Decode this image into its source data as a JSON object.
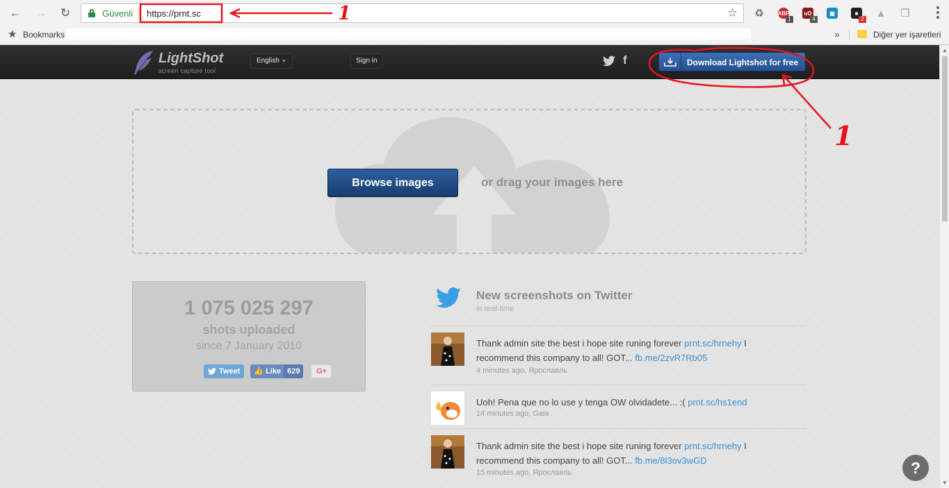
{
  "browser": {
    "secure_label": "Güvenli",
    "url": "https://prnt.sc",
    "bookmarks_label": "Bookmarks",
    "other_bookmarks": "Diğer yer işaretleri",
    "extensions": [
      {
        "name": "recycle",
        "badge": ""
      },
      {
        "name": "abp",
        "badge": "1"
      },
      {
        "name": "ublock",
        "badge": "4"
      },
      {
        "name": "reader",
        "badge": ""
      },
      {
        "name": "ext-dark",
        "badge": "2"
      },
      {
        "name": "drive",
        "badge": ""
      },
      {
        "name": "copy",
        "badge": ""
      }
    ]
  },
  "site": {
    "logo_name": "LightShot",
    "logo_tagline": "screen capture tool",
    "language": "English",
    "signin": "Sign in",
    "download": "Download Lightshot for free",
    "browse": "Browse images",
    "drag": "or drag your images here",
    "counter": {
      "number": "1 075 025 297",
      "label": "shots uploaded",
      "since": "since 7 January 2010"
    },
    "social": {
      "tweet": "Tweet",
      "like": "Like",
      "like_count": "629",
      "gplus": "G+"
    },
    "feed": {
      "title": "New screenshots on Twitter",
      "subtitle": "in real-time",
      "items": [
        {
          "text": "Thank admin site the best i hope site runing forever ",
          "link1": "prnt.sc/hrnehy",
          "text2": " I recommend this company to all! GOT... ",
          "link2": "fb.me/2zvR7Rb05",
          "meta": "4 minutes ago, Ярославль"
        },
        {
          "text": "Uoh! Pena que no lo use y tenga OW olvidadete... :( ",
          "link1": "prnt.sc/hs1end",
          "text2": "",
          "link2": "",
          "meta": "14 minutes ago, Gaia"
        },
        {
          "text": "Thank admin site the best i hope site runing forever ",
          "link1": "prnt.sc/hrnehy",
          "text2": " I recommend this company to all! GOT... ",
          "link2": "fb.me/8l3ov3wGD",
          "meta": "15 minutes ago, Ярославль"
        }
      ]
    },
    "help": "?"
  },
  "annotations": {
    "label1": "1",
    "label2": "1",
    "color": "#e8141c"
  },
  "colors": {
    "accent_blue": "#24508f",
    "link_blue": "#3b8fcf",
    "secure_green": "#2e8b3e"
  }
}
